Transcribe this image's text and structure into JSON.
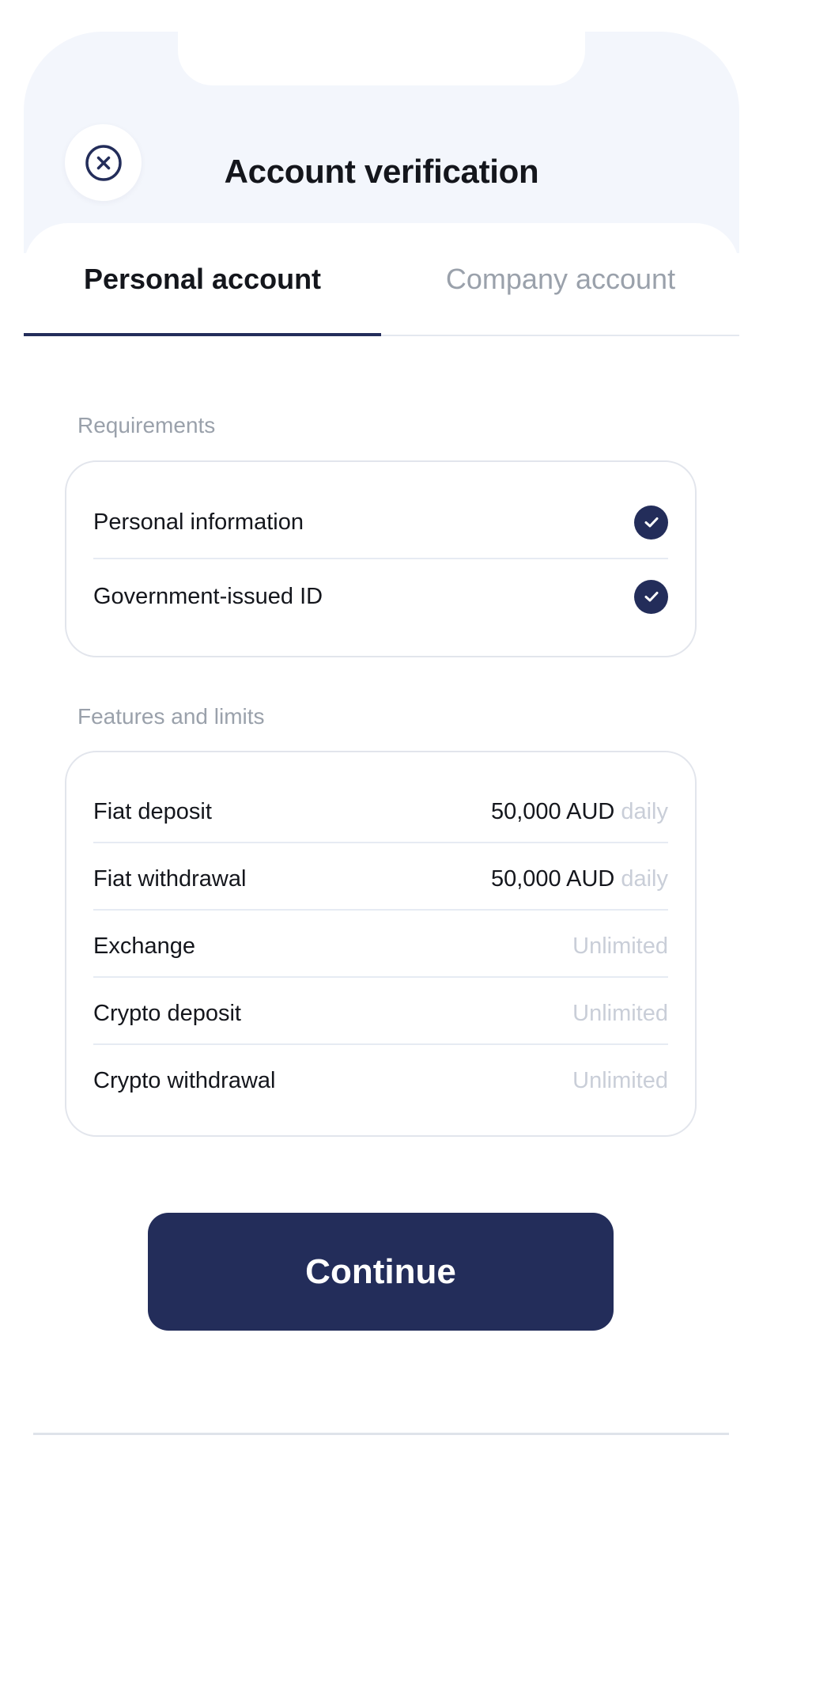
{
  "header": {
    "title": "Account verification"
  },
  "tabs": [
    {
      "label": "Personal account",
      "active": true
    },
    {
      "label": "Company account",
      "active": false
    }
  ],
  "requirements": {
    "label": "Requirements",
    "items": [
      {
        "label": "Personal information",
        "status": "check-icon"
      },
      {
        "label": "Government-issued ID",
        "status": "check-icon"
      }
    ]
  },
  "features": {
    "label": "Features and limits",
    "items": [
      {
        "label": "Fiat deposit",
        "value": "50,000 AUD",
        "period": "daily"
      },
      {
        "label": "Fiat withdrawal",
        "value": "50,000 AUD",
        "period": "daily"
      },
      {
        "label": "Exchange",
        "value": "Unlimited"
      },
      {
        "label": "Crypto deposit",
        "value": "Unlimited"
      },
      {
        "label": "Crypto withdrawal",
        "value": "Unlimited"
      }
    ]
  },
  "continue_label": "Continue",
  "colors": {
    "primary": "#232d5a",
    "header_bg": "#f3f6fc",
    "muted_text": "#9aa1ab",
    "faint_text": "#c9ced8"
  }
}
